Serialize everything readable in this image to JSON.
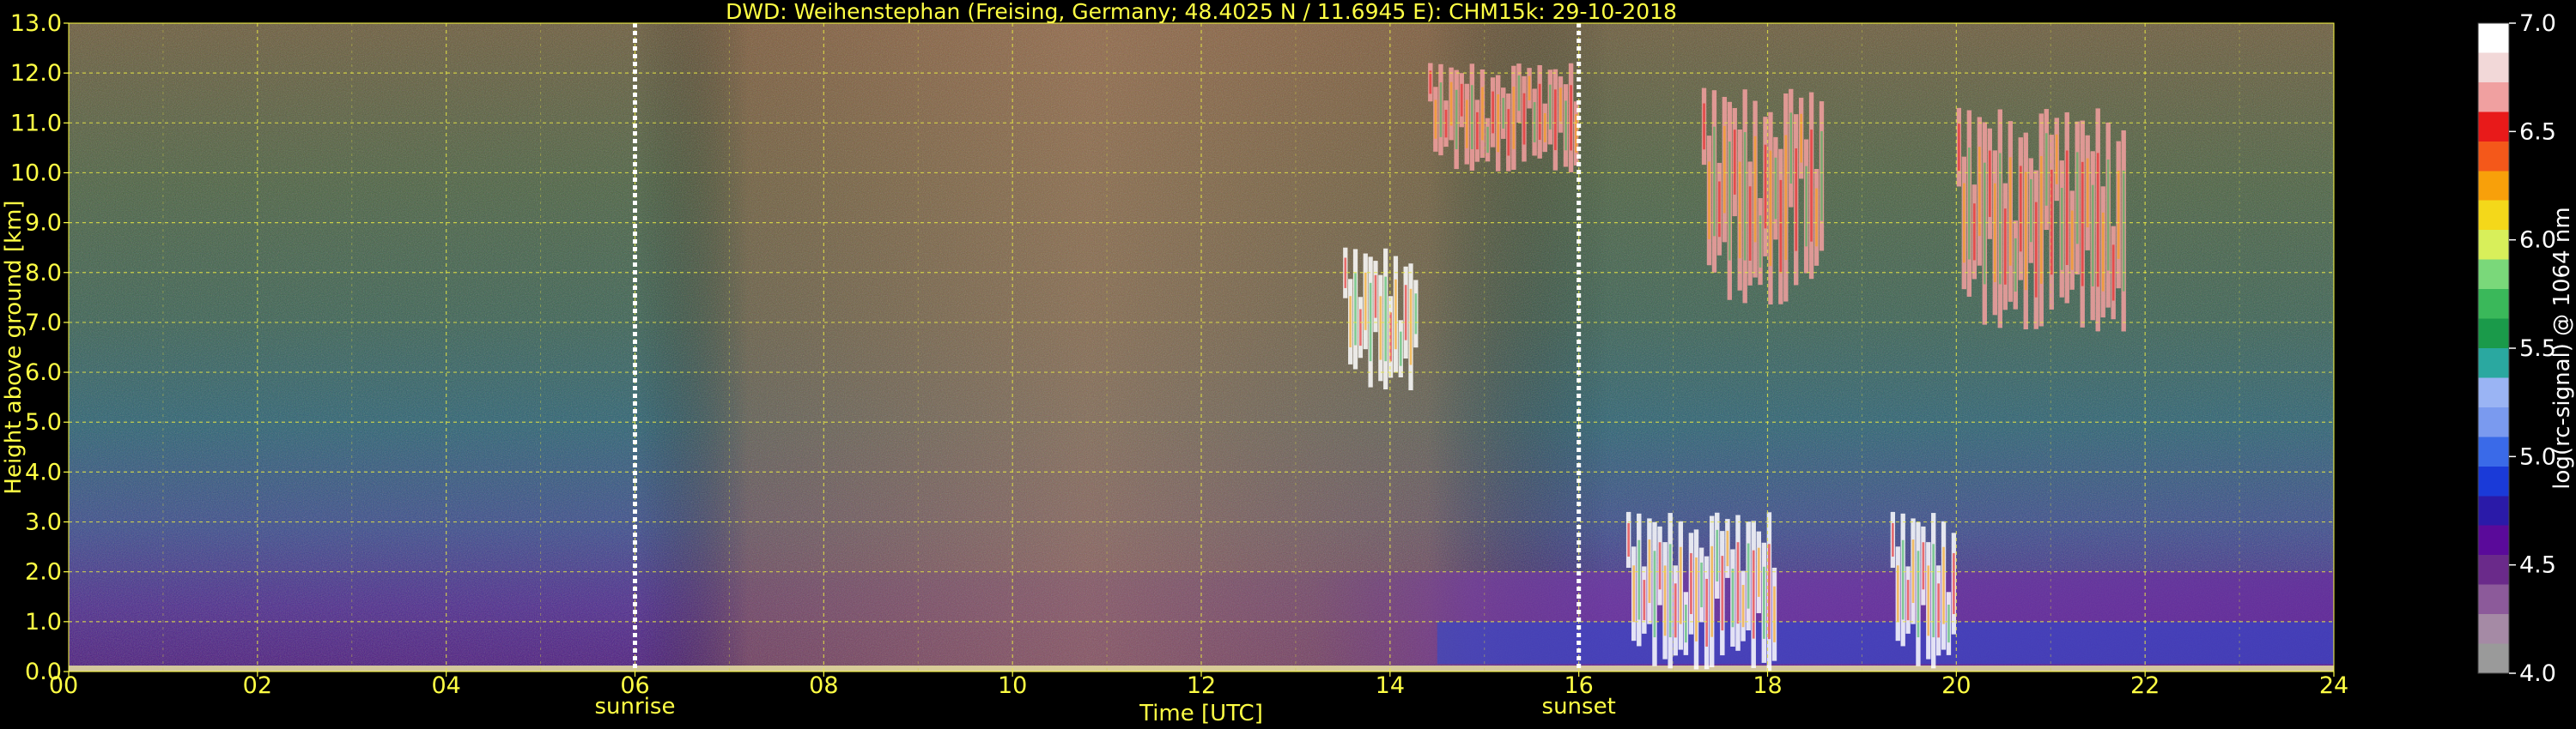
{
  "chart_data": {
    "type": "heatmap",
    "title": "DWD: Weihenstephan (Freising, Germany; 48.4025 N / 11.6945 E):    CHM15k: 29-10-2018",
    "xlabel": "Time [UTC]",
    "ylabel": "Height above ground [km]",
    "xlim": [
      0,
      24
    ],
    "ylim": [
      0,
      13
    ],
    "x_ticks": [
      "00",
      "02",
      "04",
      "06",
      "08",
      "10",
      "12",
      "14",
      "16",
      "18",
      "20",
      "22",
      "24"
    ],
    "y_ticks": [
      "0.0",
      "1.0",
      "2.0",
      "3.0",
      "4.0",
      "5.0",
      "6.0",
      "7.0",
      "8.0",
      "9.0",
      "10.0",
      "11.0",
      "12.0",
      "13.0"
    ],
    "grid": true,
    "colorbar": {
      "label": "log(rc-signal) @ 1064 nm",
      "range": [
        4.0,
        7.0
      ],
      "ticks": [
        "4.0",
        "4.5",
        "5.0",
        "5.5",
        "6.0",
        "6.5",
        "7.0"
      ],
      "colors": [
        "#9a9a9a",
        "#a58aa5",
        "#8c5a9a",
        "#6a2a8a",
        "#5a0a9a",
        "#2a1aa8",
        "#1a3ad8",
        "#3a6ae8",
        "#7a9aef",
        "#9ab4f4",
        "#2aa8a0",
        "#1a9a4a",
        "#3ab85a",
        "#7ad87a",
        "#d8ef5a",
        "#f4d81a",
        "#f8a00a",
        "#f4581a",
        "#e81a1a",
        "#f0a0a0",
        "#f2d8d8",
        "#ffffff"
      ]
    },
    "events": [
      {
        "label": "sunrise",
        "x": 6.0
      },
      {
        "label": "sunset",
        "x": 16.0
      }
    ],
    "features": [
      {
        "type": "boundary layer",
        "x": [
          0,
          24
        ],
        "y": [
          0,
          1.0
        ]
      },
      {
        "type": "low cloud",
        "x": [
          16.5,
          18.1
        ],
        "y": [
          0,
          3.2
        ]
      },
      {
        "type": "low cloud",
        "x": [
          19.3,
          20.0
        ],
        "y": [
          0,
          3.2
        ]
      },
      {
        "type": "cirrus",
        "x": [
          14.4,
          16.0
        ],
        "y": [
          10.0,
          12.2
        ]
      },
      {
        "type": "cirrus",
        "x": [
          17.3,
          18.6
        ],
        "y": [
          7.3,
          11.7
        ]
      },
      {
        "type": "cirrus",
        "x": [
          20.0,
          21.8
        ],
        "y": [
          6.8,
          11.3
        ]
      },
      {
        "type": "cloud",
        "x": [
          13.5,
          14.3
        ],
        "y": [
          5.6,
          8.5
        ]
      }
    ]
  }
}
